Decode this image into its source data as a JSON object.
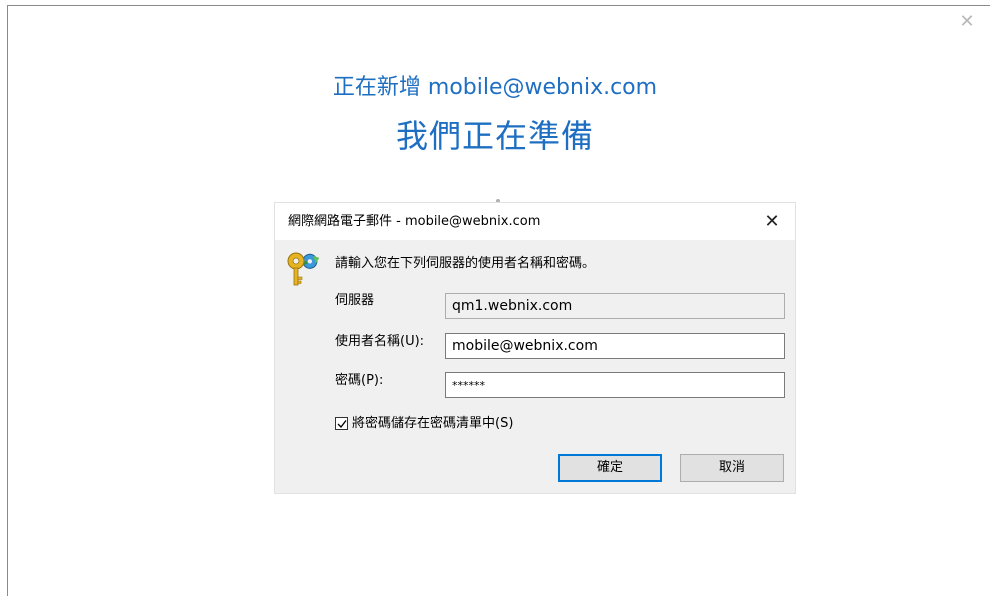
{
  "page": {
    "adding_text": "正在新增 mobile@webnix.com",
    "preparing_text": "我們正在準備",
    "outer_close_icon": "close-icon"
  },
  "dialog": {
    "title": "網際網路電子郵件 - mobile@webnix.com",
    "close_icon": "close-icon",
    "key_icon": "key-icon",
    "prompt": "請輸入您在下列伺服器的使用者名稱和密碼。",
    "server_label": "伺服器",
    "server_value": "qm1.webnix.com",
    "username_label": "使用者名稱(U):",
    "username_value": "mobile@webnix.com",
    "password_label": "密碼(P):",
    "password_value": "******",
    "save_password_label": "將密碼儲存在密碼清單中(S)",
    "save_password_checked": true,
    "ok_label": "確定",
    "cancel_label": "取消"
  },
  "colors": {
    "accent": "#1e6fc2",
    "dialog_bg": "#f0f0f0",
    "default_button_border": "#0078d7"
  }
}
